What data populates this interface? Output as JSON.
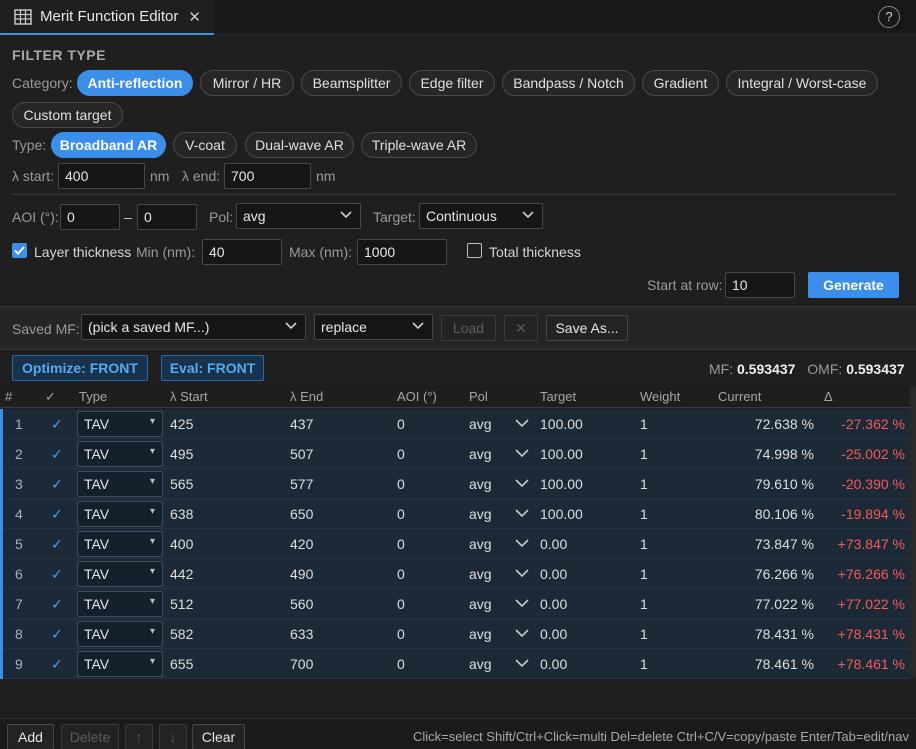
{
  "tab": {
    "title": "Merit Function Editor",
    "close": "✕",
    "help": "?"
  },
  "filter": {
    "section_title": "FILTER TYPE",
    "category_label": "Category:",
    "categories": [
      "Anti-reflection",
      "Mirror / HR",
      "Beamsplitter",
      "Edge filter",
      "Bandpass / Notch",
      "Gradient",
      "Integral / Worst-case",
      "Custom target"
    ],
    "category_selected": "Anti-reflection",
    "type_label": "Type:",
    "types": [
      "Broadband AR",
      "V-coat",
      "Dual-wave AR",
      "Triple-wave AR"
    ],
    "type_selected": "Broadband AR",
    "lambda_start_label": "λ start:",
    "lambda_start": "400",
    "lambda_start_unit": "nm",
    "lambda_end_label": "λ end:",
    "lambda_end": "700",
    "lambda_end_unit": "nm",
    "aoi_label": "AOI (°):",
    "aoi_from": "0",
    "aoi_sep": "–",
    "aoi_to": "0",
    "pol_label": "Pol:",
    "pol_value": "avg",
    "target_label": "Target:",
    "target_value": "Continuous",
    "layer_thickness_label": "Layer thickness",
    "layer_thickness_checked": true,
    "min_label": "Min (nm):",
    "min_value": "40",
    "max_label": "Max (nm):",
    "max_value": "1000",
    "total_thickness_label": "Total thickness",
    "total_thickness_checked": false,
    "start_row_label": "Start at row:",
    "start_row_value": "10",
    "generate_label": "Generate"
  },
  "saved": {
    "label": "Saved MF:",
    "select_value": "(pick a saved MF...)",
    "mode_value": "replace",
    "load_label": "Load",
    "delete_glyph": "✕",
    "save_as_label": "Save As..."
  },
  "status": {
    "optimize_label": "Optimize: FRONT",
    "eval_label": "Eval: FRONT",
    "mf_label": "MF:",
    "mf_value": "0.593437",
    "omf_label": "OMF:",
    "omf_value": "0.593437"
  },
  "table": {
    "headers": [
      "#",
      "✓",
      "Type",
      "λ Start",
      "λ End",
      "AOI (°)",
      "Pol",
      "Target",
      "Weight",
      "Current",
      "Δ"
    ],
    "rows": [
      {
        "n": "1",
        "check": "✓",
        "type": "TAV",
        "start": "425",
        "end": "437",
        "aoi": "0",
        "pol": "avg",
        "target": "100.00",
        "weight": "1",
        "current": "72.638 %",
        "delta": "-27.362 %"
      },
      {
        "n": "2",
        "check": "✓",
        "type": "TAV",
        "start": "495",
        "end": "507",
        "aoi": "0",
        "pol": "avg",
        "target": "100.00",
        "weight": "1",
        "current": "74.998 %",
        "delta": "-25.002 %"
      },
      {
        "n": "3",
        "check": "✓",
        "type": "TAV",
        "start": "565",
        "end": "577",
        "aoi": "0",
        "pol": "avg",
        "target": "100.00",
        "weight": "1",
        "current": "79.610 %",
        "delta": "-20.390 %"
      },
      {
        "n": "4",
        "check": "✓",
        "type": "TAV",
        "start": "638",
        "end": "650",
        "aoi": "0",
        "pol": "avg",
        "target": "100.00",
        "weight": "1",
        "current": "80.106 %",
        "delta": "-19.894 %"
      },
      {
        "n": "5",
        "check": "✓",
        "type": "TAV",
        "start": "400",
        "end": "420",
        "aoi": "0",
        "pol": "avg",
        "target": "0.00",
        "weight": "1",
        "current": "73.847 %",
        "delta": "+73.847 %"
      },
      {
        "n": "6",
        "check": "✓",
        "type": "TAV",
        "start": "442",
        "end": "490",
        "aoi": "0",
        "pol": "avg",
        "target": "0.00",
        "weight": "1",
        "current": "76.266 %",
        "delta": "+76.266 %"
      },
      {
        "n": "7",
        "check": "✓",
        "type": "TAV",
        "start": "512",
        "end": "560",
        "aoi": "0",
        "pol": "avg",
        "target": "0.00",
        "weight": "1",
        "current": "77.022 %",
        "delta": "+77.022 %"
      },
      {
        "n": "8",
        "check": "✓",
        "type": "TAV",
        "start": "582",
        "end": "633",
        "aoi": "0",
        "pol": "avg",
        "target": "0.00",
        "weight": "1",
        "current": "78.431 %",
        "delta": "+78.431 %"
      },
      {
        "n": "9",
        "check": "✓",
        "type": "TAV",
        "start": "655",
        "end": "700",
        "aoi": "0",
        "pol": "avg",
        "target": "0.00",
        "weight": "1",
        "current": "78.461 %",
        "delta": "+78.461 %"
      }
    ]
  },
  "footer": {
    "add_label": "Add",
    "delete_label": "Delete",
    "up_label": "↑",
    "down_label": "↓",
    "clear_label": "Clear",
    "hint": "Click=select Shift/Ctrl+Click=multi Del=delete Ctrl+C/V=copy/paste Enter/Tab=edit/nav"
  },
  "colors": {
    "accent": "#3b8eea",
    "delta": "#f25a5a",
    "row_bg": "#1c2a38"
  }
}
